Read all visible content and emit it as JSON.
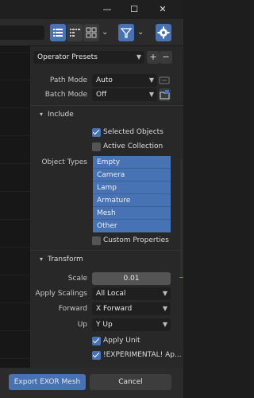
{
  "window": {
    "minimize_glyph": "—",
    "maximize_glyph": "☐",
    "close_glyph": "✕"
  },
  "toolbar": {
    "view_icons": [
      "list-vertical-icon",
      "list-horizontal-icon",
      "thumbnails-icon"
    ],
    "filter_icon": "filter-icon",
    "settings_icon": "gear-icon",
    "chevron": "⌄",
    "accent": "#4772b3"
  },
  "presets": {
    "label": "Operator Presets",
    "add": "+",
    "remove": "−"
  },
  "fields": {
    "path_mode_label": "Path Mode",
    "path_mode_value": "Auto",
    "batch_mode_label": "Batch Mode",
    "batch_mode_value": "Off"
  },
  "include": {
    "title": "Include",
    "selected_objects": {
      "label": "Selected Objects",
      "checked": true
    },
    "active_collection": {
      "label": "Active Collection",
      "checked": false
    },
    "object_types_label": "Object Types",
    "object_types": [
      "Empty",
      "Camera",
      "Lamp",
      "Armature",
      "Mesh",
      "Other"
    ],
    "custom_properties": {
      "label": "Custom Properties",
      "checked": false
    }
  },
  "transform": {
    "title": "Transform",
    "scale_label": "Scale",
    "scale_value": "0.01",
    "apply_scalings_label": "Apply Scalings",
    "apply_scalings_value": "All Local",
    "forward_label": "Forward",
    "forward_value": "X Forward",
    "up_label": "Up",
    "up_value": "Y Up",
    "apply_unit": {
      "label": "Apply Unit",
      "checked": true
    },
    "experimental": {
      "label": "!EXPERIMENTAL! Ap...",
      "checked": true
    }
  },
  "footer": {
    "export_label": "Export EXOR Mesh",
    "cancel_label": "Cancel"
  }
}
